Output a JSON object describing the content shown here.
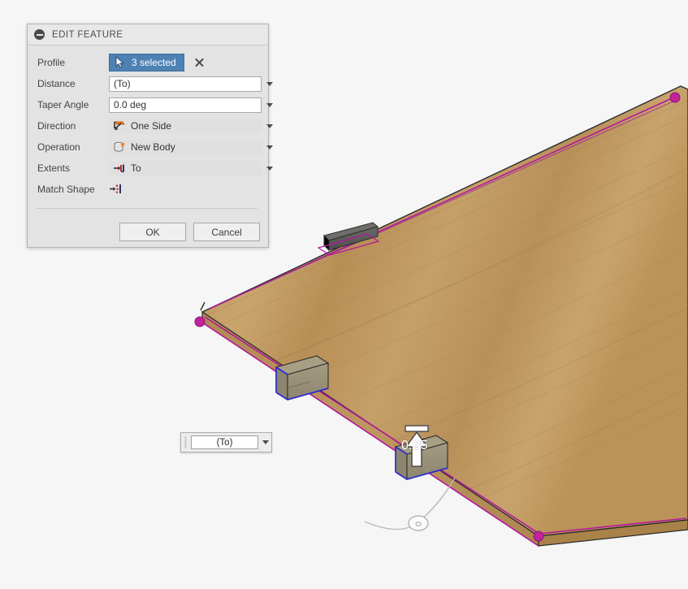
{
  "app": {
    "background_color": "#f6f6f6"
  },
  "dialog": {
    "title": "EDIT FEATURE",
    "collapse_icon": "minus-circle-icon",
    "rows": [
      {
        "label": "Profile",
        "type": "selection",
        "value": "3 selected",
        "icon": "cursor-arrow-icon",
        "clear_icon": "close-x-icon"
      },
      {
        "label": "Distance",
        "type": "text",
        "value": "(To)",
        "icon": null
      },
      {
        "label": "Taper Angle",
        "type": "text",
        "value": "0.0 deg",
        "icon": null
      },
      {
        "label": "Direction",
        "type": "combo",
        "value": "One Side",
        "icon": "one-side-direction-icon"
      },
      {
        "label": "Operation",
        "type": "combo",
        "value": "New Body",
        "icon": "new-body-icon"
      },
      {
        "label": "Extents",
        "type": "combo",
        "value": "To",
        "icon": "extent-to-icon"
      },
      {
        "label": "Match Shape",
        "type": "toggle-icon",
        "value": "",
        "icon": "match-shape-icon"
      }
    ],
    "buttons": {
      "ok": "OK",
      "cancel": "Cancel"
    },
    "colors": {
      "selection_blue": "#4e82b4",
      "panel_gray": "#e3e3e3",
      "title_gray": "#e8e8e8"
    }
  },
  "canvas_value_editor": {
    "value": "(To)",
    "grip_icon": "drag-grip-icon",
    "caret_icon": "chevron-down-icon"
  },
  "manipulator": {
    "dimension_label": "0.25",
    "arrow_icon": "extrude-up-arrow-icon",
    "handle_icon": "drag-circle-handle-icon"
  },
  "model": {
    "board_name": "wood-board",
    "board_colors": {
      "top": "#c39b63",
      "edge": "#a07b47",
      "side": "#b88d53"
    },
    "sketch_color": "#b5179e",
    "vertex_color": "#c1239b",
    "highlight_edge_color": "#2b2bd0",
    "blocks": [
      {
        "name": "hinge-block",
        "color": "#5a5a58"
      },
      {
        "name": "cleat-block-left",
        "color": "#9c9479"
      },
      {
        "name": "cleat-block-right",
        "color": "#9c9479"
      }
    ]
  }
}
